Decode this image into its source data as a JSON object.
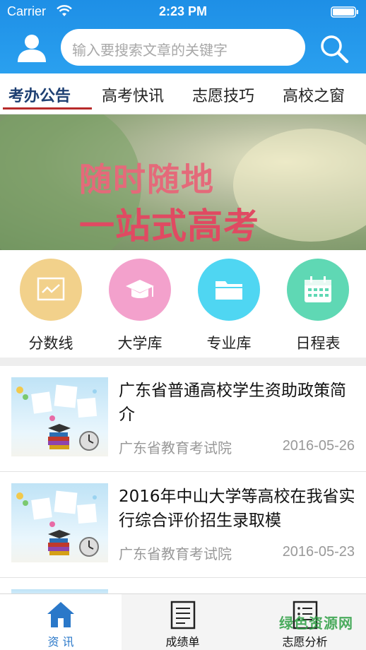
{
  "status_bar": {
    "carrier": "Carrier",
    "time": "2:23 PM"
  },
  "header": {
    "search_placeholder": "输入要搜索文章的关键字",
    "icons": {
      "user": "user-icon",
      "search": "search-icon"
    }
  },
  "tabs": [
    {
      "label": "考办公告",
      "active": true
    },
    {
      "label": "高考快讯",
      "active": false
    },
    {
      "label": "志愿技巧",
      "active": false
    },
    {
      "label": "高校之窗",
      "active": false
    }
  ],
  "banner": {
    "line1": "随时随地",
    "line2": "一站式高考"
  },
  "quick_links": [
    {
      "label": "分数线",
      "icon": "chart-icon",
      "color": "#f2d18b"
    },
    {
      "label": "大学库",
      "icon": "graduation-cap-icon",
      "color": "#f3a1cc"
    },
    {
      "label": "专业库",
      "icon": "folder-icon",
      "color": "#4fd6f2"
    },
    {
      "label": "日程表",
      "icon": "calendar-icon",
      "color": "#5fd8b4"
    }
  ],
  "news": [
    {
      "title": "广东省普通高校学生资助政策简介",
      "source": "广东省教育考试院",
      "date": "2016-05-26"
    },
    {
      "title": "2016年中山大学等高校在我省实行综合评价招生录取模",
      "source": "广东省教育考试院",
      "date": "2016-05-23"
    }
  ],
  "tabbar": [
    {
      "label": "资 讯",
      "icon": "home-icon",
      "active": true
    },
    {
      "label": "成绩单",
      "icon": "report-icon",
      "active": false
    },
    {
      "label": "志愿分析",
      "icon": "list-icon",
      "active": false
    }
  ],
  "watermark": "绿色资源网",
  "colors": {
    "header_blue": "#1e8fe6",
    "tab_active": "#1d3f72",
    "tab_underline": "#b72a2a",
    "tabbar_active": "#2a78c9"
  }
}
